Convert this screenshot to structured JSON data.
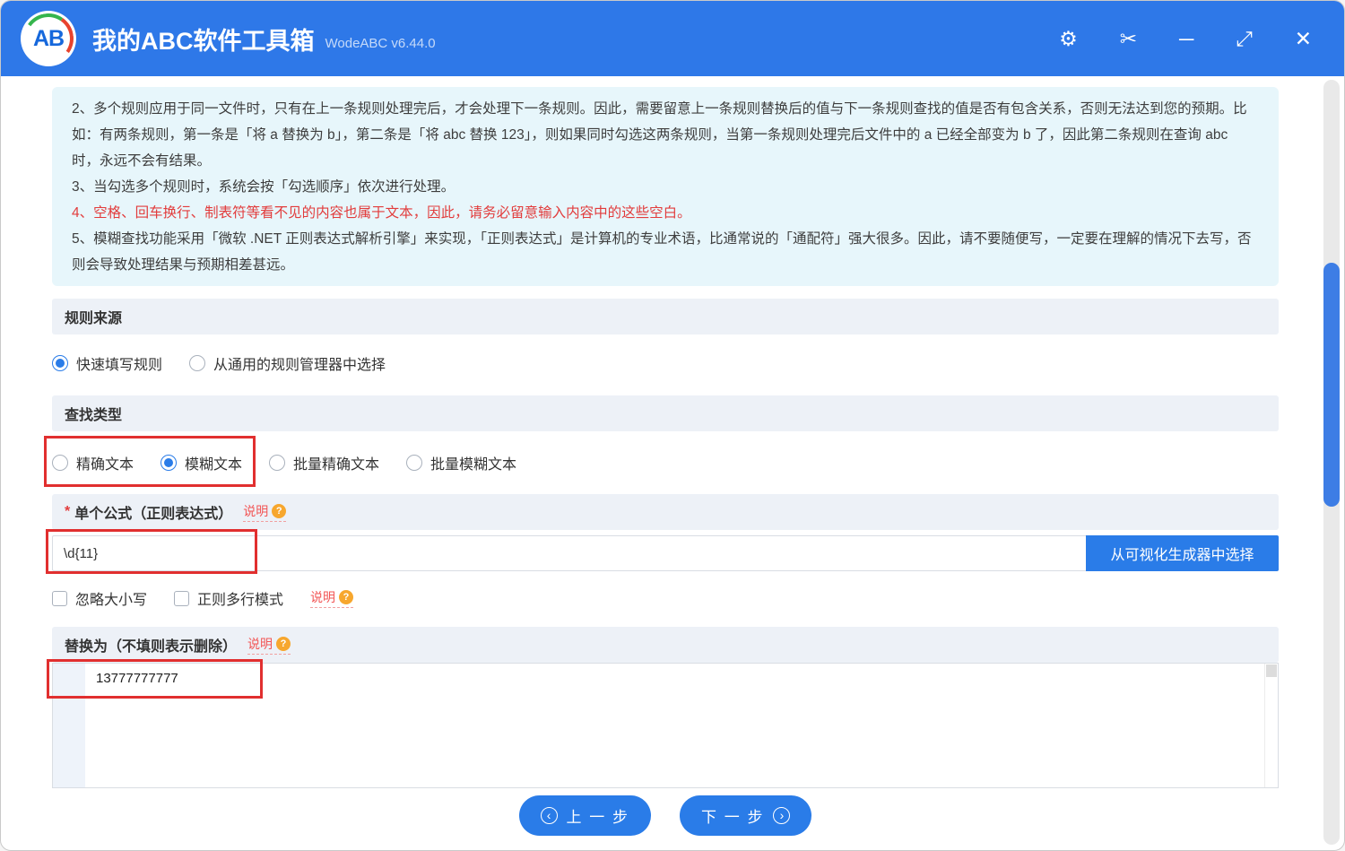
{
  "window": {
    "title": "我的ABC软件工具箱",
    "version": "WodeABC v6.44.0",
    "logo_text": "AB"
  },
  "titlebar": {
    "icons": {
      "settings": "⚙",
      "cut": "✂",
      "minimize": "─",
      "maximize": "⤢",
      "close": "✕"
    }
  },
  "notice": {
    "items": [
      {
        "text": "2、多个规则应用于同一文件时，只有在上一条规则处理完后，才会处理下一条规则。因此，需要留意上一条规则替换后的值与下一条规则查找的值是否有包含关系，否则无法达到您的预期。比如：有两条规则，第一条是「将 a 替换为 b」，第二条是「将 abc 替换 123」，则如果同时勾选这两条规则，当第一条规则处理完后文件中的 a 已经全部变为 b 了，因此第二条规则在查询 abc 时，永远不会有结果。",
        "highlight": false
      },
      {
        "text": "3、当勾选多个规则时，系统会按「勾选顺序」依次进行处理。",
        "highlight": false
      },
      {
        "text": "4、空格、回车换行、制表符等看不见的内容也属于文本，因此，请务必留意输入内容中的这些空白。",
        "highlight": true
      },
      {
        "text": "5、模糊查找功能采用「微软 .NET 正则表达式解析引擎」来实现，「正则表达式」是计算机的专业术语，比通常说的「通配符」强大很多。因此，请不要随便写，一定要在理解的情况下去写，否则会导致处理结果与预期相差甚远。",
        "highlight": false
      }
    ]
  },
  "rule_source": {
    "title": "规则来源",
    "options": [
      {
        "label": "快速填写规则",
        "selected": true
      },
      {
        "label": "从通用的规则管理器中选择",
        "selected": false
      }
    ]
  },
  "search_type": {
    "title": "查找类型",
    "options": [
      {
        "label": "精确文本",
        "selected": false
      },
      {
        "label": "模糊文本",
        "selected": true
      },
      {
        "label": "批量精确文本",
        "selected": false
      },
      {
        "label": "批量模糊文本",
        "selected": false
      }
    ]
  },
  "formula": {
    "required_mark": "*",
    "title": "单个公式（正则表达式）",
    "help_label": "说明",
    "help_icon": "?",
    "input_value": "\\d{11}",
    "picker_button": "从可视化生成器中选择",
    "ignore_case_label": "忽略大小写",
    "ignore_case_checked": false,
    "multiline_label": "正则多行模式",
    "multiline_checked": false,
    "multiline_help_label": "说明",
    "multiline_help_icon": "?"
  },
  "replace": {
    "title": "替换为（不填则表示删除）",
    "help_label": "说明",
    "help_icon": "?",
    "value": "13777777777"
  },
  "footer": {
    "prev_icon": "‹",
    "prev_label": "上 一 步",
    "next_label": "下 一 步",
    "next_icon": "›"
  }
}
